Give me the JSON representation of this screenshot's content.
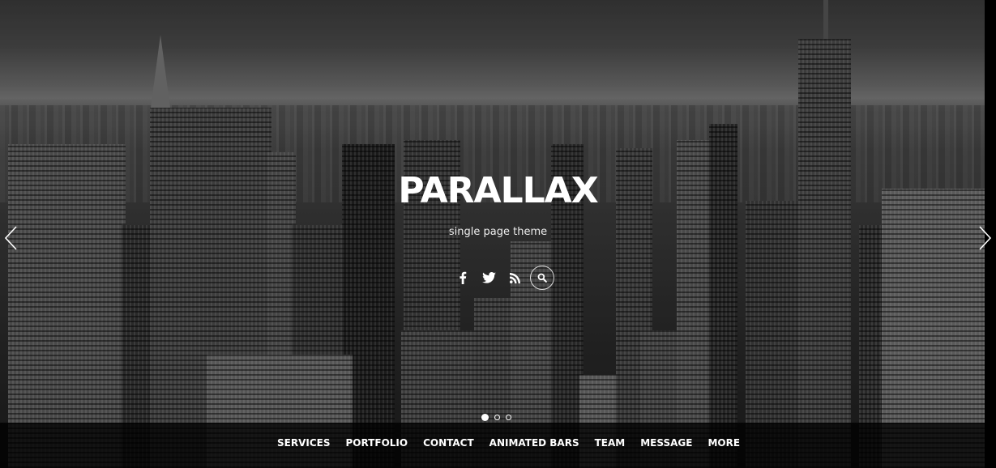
{
  "hero": {
    "title": "PARALLAX",
    "tagline": "single page theme"
  },
  "social": [
    {
      "name": "facebook",
      "icon": "facebook-icon"
    },
    {
      "name": "twitter",
      "icon": "twitter-icon"
    },
    {
      "name": "rss",
      "icon": "rss-icon"
    },
    {
      "name": "search",
      "icon": "search-icon"
    }
  ],
  "slider": {
    "prev_icon": "chevron-left-icon",
    "next_icon": "chevron-right-icon",
    "slide_count": 3,
    "active_slide": 1
  },
  "nav": {
    "items": [
      {
        "label": "SERVICES"
      },
      {
        "label": "PORTFOLIO"
      },
      {
        "label": "CONTACT"
      },
      {
        "label": "ANIMATED BARS"
      },
      {
        "label": "TEAM"
      },
      {
        "label": "MESSAGE"
      },
      {
        "label": "MORE"
      }
    ]
  },
  "colors": {
    "text": "#ffffff",
    "navbar_bg": "#000000"
  }
}
